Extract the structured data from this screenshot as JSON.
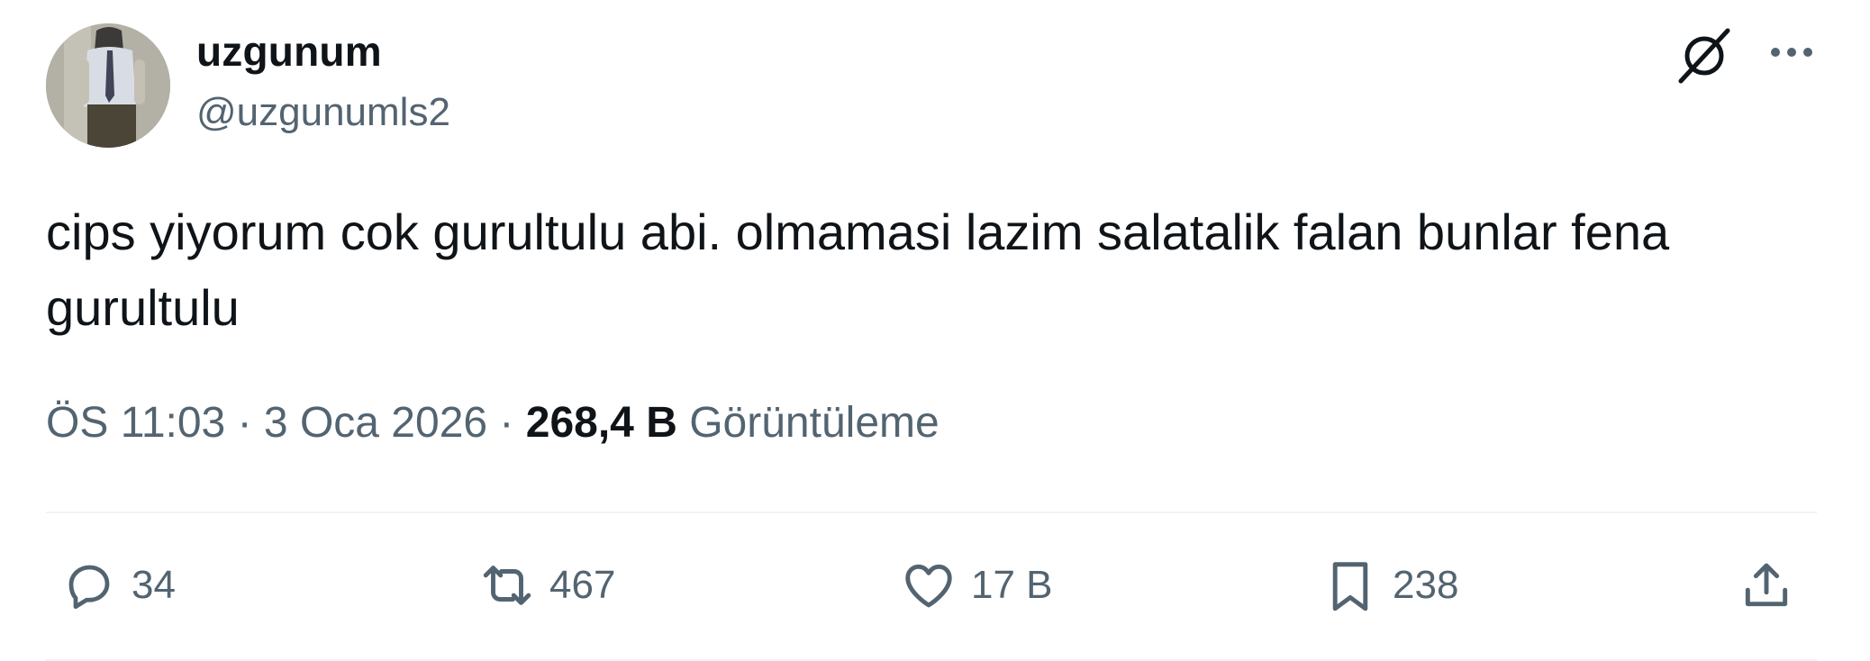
{
  "author": {
    "display_name": "uzgunum",
    "handle": "@uzgunumls2",
    "avatar": "profile-avatar"
  },
  "tweet": {
    "text": "cips yiyorum cok gurultulu abi. olmamasi lazim salatalik falan bunlar fena gurultulu"
  },
  "meta": {
    "time": "ÖS 11:03",
    "separator1": " · ",
    "date": "3 Oca 2026",
    "separator2": " · ",
    "views_count": "268,4 B",
    "views_label": " Görüntüleme"
  },
  "header_icons": {
    "grok": "grok-icon",
    "more": "more-icon"
  },
  "actions": {
    "reply": {
      "icon": "reply-icon",
      "count": "34"
    },
    "retweet": {
      "icon": "retweet-icon",
      "count": "467"
    },
    "like": {
      "icon": "heart-icon",
      "count": "17 B"
    },
    "bookmark": {
      "icon": "bookmark-icon",
      "count": "238"
    },
    "share": {
      "icon": "share-icon"
    }
  },
  "colors": {
    "text_primary": "#0f1419",
    "text_secondary": "#536471",
    "divider": "#eff3f4"
  }
}
